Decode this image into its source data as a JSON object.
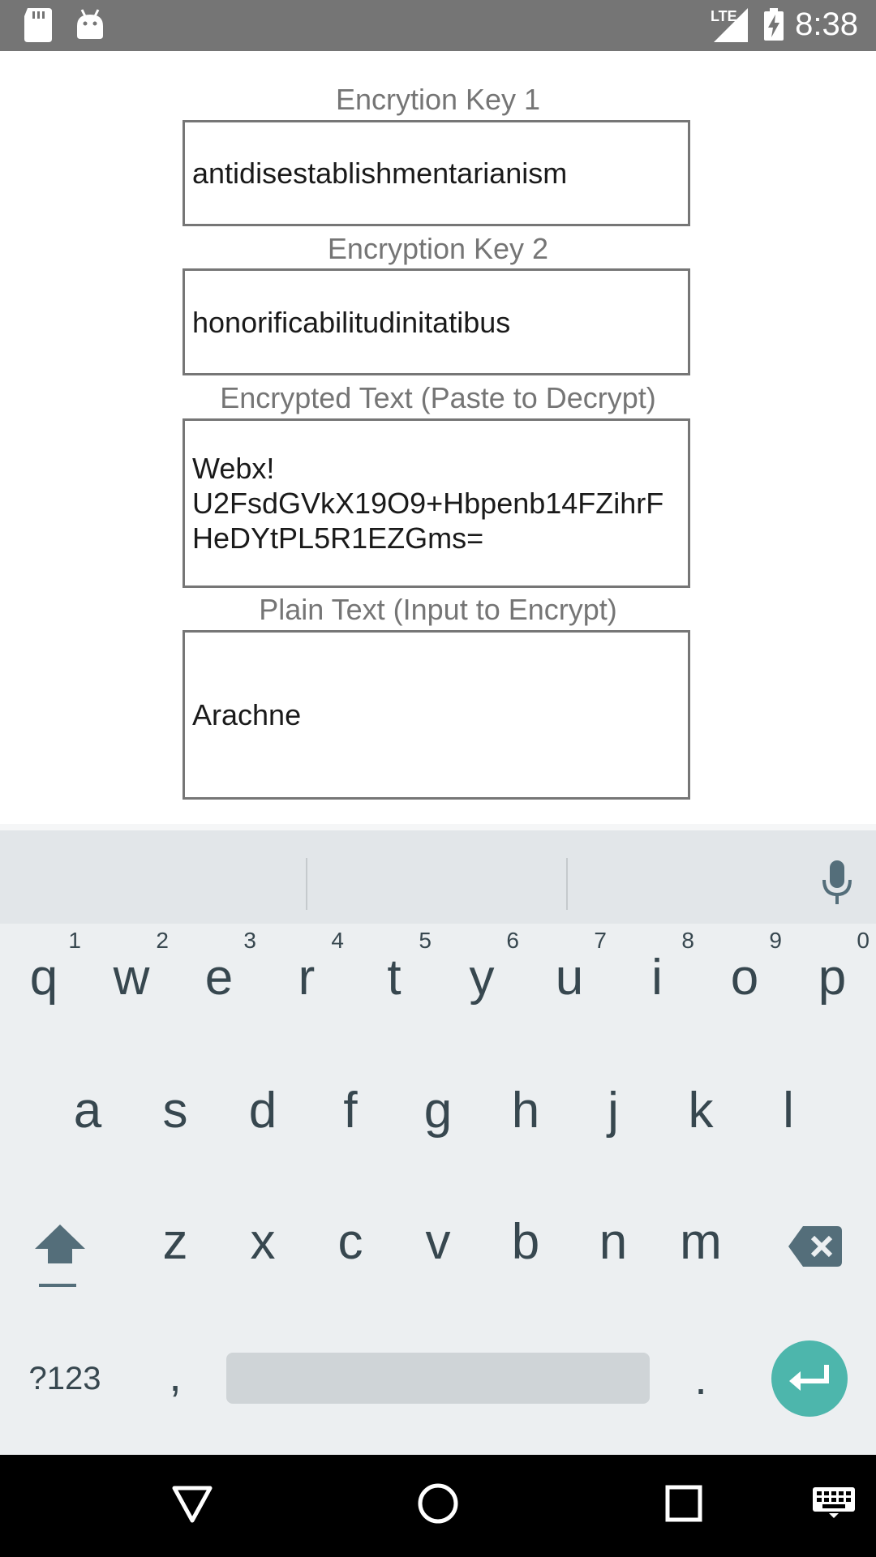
{
  "status_bar": {
    "time": "8:38",
    "network": "LTE",
    "icons": [
      "sd-card-icon",
      "android-icon",
      "lte-signal-icon",
      "battery-charging-icon"
    ]
  },
  "form": {
    "key1": {
      "label": "Encrytion Key 1",
      "value": "antidisestablishmentarianism"
    },
    "key2": {
      "label": "Encryption Key 2",
      "value": "honorificabilitudinitatibus"
    },
    "encrypted": {
      "label": "Encrypted Text (Paste to Decrypt)",
      "value": "Webx!\nU2FsdGVkX19O9+Hbpenb14FZihrFHeDYtPL5R1EZGms="
    },
    "plain": {
      "label": "Plain Text (Input to Encrypt)",
      "value": "Arachne"
    }
  },
  "keyboard": {
    "row1": [
      {
        "key": "q",
        "hint": "1"
      },
      {
        "key": "w",
        "hint": "2"
      },
      {
        "key": "e",
        "hint": "3"
      },
      {
        "key": "r",
        "hint": "4"
      },
      {
        "key": "t",
        "hint": "5"
      },
      {
        "key": "y",
        "hint": "6"
      },
      {
        "key": "u",
        "hint": "7"
      },
      {
        "key": "i",
        "hint": "8"
      },
      {
        "key": "o",
        "hint": "9"
      },
      {
        "key": "p",
        "hint": "0"
      }
    ],
    "row2": [
      "a",
      "s",
      "d",
      "f",
      "g",
      "h",
      "j",
      "k",
      "l"
    ],
    "row3": [
      "z",
      "x",
      "c",
      "v",
      "b",
      "n",
      "m"
    ],
    "symbols_label": "?123",
    "comma": ",",
    "period": ".",
    "icons": [
      "mic-icon",
      "shift-icon",
      "backspace-icon",
      "enter-icon"
    ]
  },
  "nav_bar": {
    "icons": [
      "back-icon",
      "home-icon",
      "recents-icon",
      "keyboard-switch-icon"
    ]
  },
  "colors": {
    "status_bar": "#757575",
    "keyboard_bg": "#eceff1",
    "enter_accent": "#4db6ac",
    "label_gray": "#757575"
  }
}
